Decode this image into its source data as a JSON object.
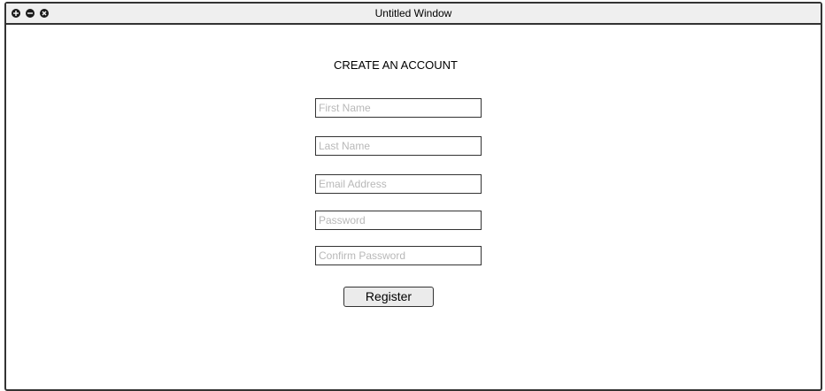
{
  "window": {
    "title": "Untitled Window",
    "controls": [
      "add-icon",
      "minimize-icon",
      "close-icon"
    ]
  },
  "form": {
    "heading": "CREATE AN ACCOUNT",
    "fields": [
      {
        "placeholder": "First Name",
        "value": ""
      },
      {
        "placeholder": "Last Name",
        "value": ""
      },
      {
        "placeholder": "Email Address",
        "value": ""
      },
      {
        "placeholder": "Password",
        "value": ""
      },
      {
        "placeholder": "Confirm Password",
        "value": ""
      }
    ],
    "submit_label": "Register"
  },
  "colors": {
    "border": "#333333",
    "titlebar": "#efefef",
    "placeholder": "#b8b8b8",
    "button": "#ebebeb"
  }
}
